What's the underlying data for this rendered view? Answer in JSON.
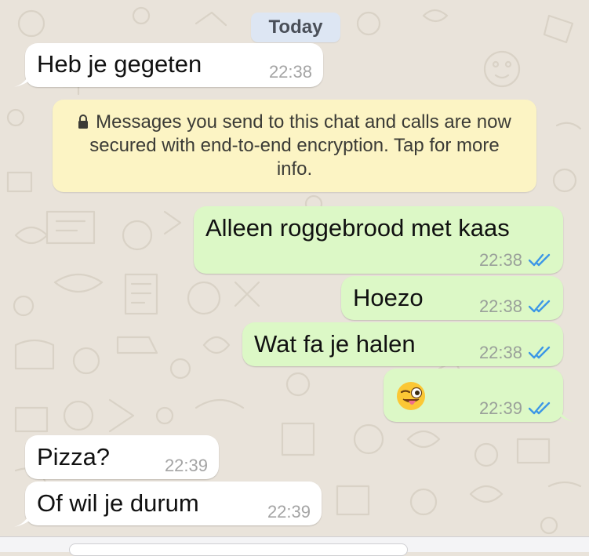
{
  "chat": {
    "date_label": "Today",
    "encryption_notice": "Messages you send to this chat and calls are now secured with end-to-end encryption. Tap for more info.",
    "messages": [
      {
        "direction": "incoming",
        "text": "Heb je gegeten",
        "time": "22:38"
      },
      {
        "direction": "outgoing",
        "text": "Alleen roggebrood met kaas",
        "time": "22:38",
        "status": "read"
      },
      {
        "direction": "outgoing",
        "text": "Hoezo",
        "time": "22:38",
        "status": "read"
      },
      {
        "direction": "outgoing",
        "text": "Wat fa je halen",
        "time": "22:38",
        "status": "read"
      },
      {
        "direction": "outgoing",
        "text": "😜",
        "time": "22:39",
        "status": "read"
      },
      {
        "direction": "incoming",
        "text": "Pizza?",
        "time": "22:39"
      },
      {
        "direction": "incoming",
        "text": "Of wil je durum",
        "time": "22:39"
      }
    ]
  },
  "icons": {
    "lock": "lock-icon",
    "read_ticks": "double-check-icon",
    "emoji": "winking-face-with-tongue"
  },
  "colors": {
    "background": "#e9e3da",
    "incoming_bubble": "#ffffff",
    "outgoing_bubble": "#dcf8c6",
    "notice_bubble": "#fcf4c4",
    "date_chip": "#dde6f3",
    "read_ticks": "#3c97e6"
  }
}
